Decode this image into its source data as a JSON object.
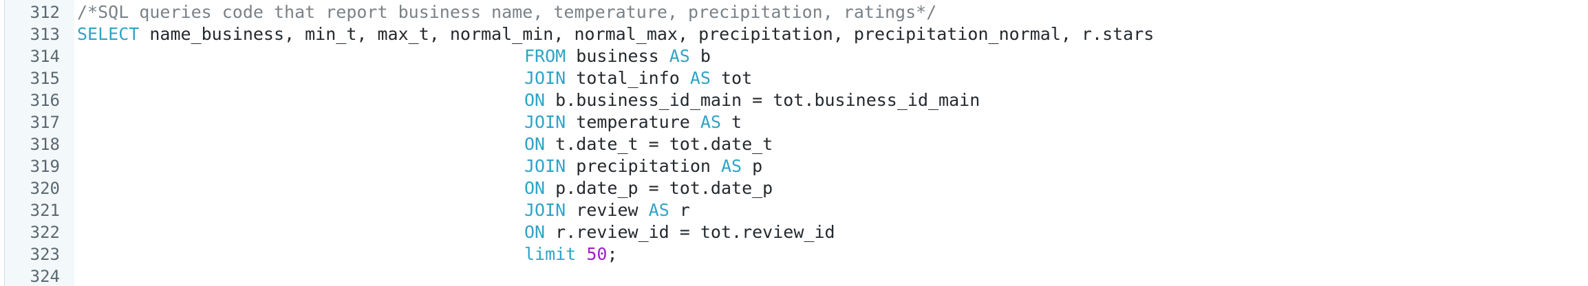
{
  "editor": {
    "lines": [
      {
        "num": "312",
        "indent": false,
        "tokens": [
          {
            "t": "comment",
            "v": "/*SQL queries code that report business name, temperature, precipitation, ratings*/"
          }
        ]
      },
      {
        "num": "313",
        "indent": false,
        "tokens": [
          {
            "t": "keyword",
            "v": "SELECT"
          },
          {
            "t": "plain",
            "v": " name_business, min_t, max_t, normal_min, normal_max, precipitation, precipitation_normal, r.stars"
          }
        ]
      },
      {
        "num": "314",
        "indent": true,
        "tokens": [
          {
            "t": "keyword",
            "v": "FROM"
          },
          {
            "t": "plain",
            "v": " business "
          },
          {
            "t": "keyword",
            "v": "AS"
          },
          {
            "t": "plain",
            "v": " b"
          }
        ]
      },
      {
        "num": "315",
        "indent": true,
        "tokens": [
          {
            "t": "keyword",
            "v": "JOIN"
          },
          {
            "t": "plain",
            "v": " total_info "
          },
          {
            "t": "keyword",
            "v": "AS"
          },
          {
            "t": "plain",
            "v": " tot"
          }
        ]
      },
      {
        "num": "316",
        "indent": true,
        "tokens": [
          {
            "t": "keyword",
            "v": "ON"
          },
          {
            "t": "plain",
            "v": " b.business_id_main = tot.business_id_main"
          }
        ]
      },
      {
        "num": "317",
        "indent": true,
        "tokens": [
          {
            "t": "keyword",
            "v": "JOIN"
          },
          {
            "t": "plain",
            "v": " temperature "
          },
          {
            "t": "keyword",
            "v": "AS"
          },
          {
            "t": "plain",
            "v": " t"
          }
        ]
      },
      {
        "num": "318",
        "indent": true,
        "tokens": [
          {
            "t": "keyword",
            "v": "ON"
          },
          {
            "t": "plain",
            "v": " t.date_t = tot.date_t"
          }
        ]
      },
      {
        "num": "319",
        "indent": true,
        "tokens": [
          {
            "t": "keyword",
            "v": "JOIN"
          },
          {
            "t": "plain",
            "v": " precipitation "
          },
          {
            "t": "keyword",
            "v": "AS"
          },
          {
            "t": "plain",
            "v": " p"
          }
        ]
      },
      {
        "num": "320",
        "indent": true,
        "tokens": [
          {
            "t": "keyword",
            "v": "ON"
          },
          {
            "t": "plain",
            "v": " p.date_p = tot.date_p"
          }
        ]
      },
      {
        "num": "321",
        "indent": true,
        "tokens": [
          {
            "t": "keyword",
            "v": "JOIN"
          },
          {
            "t": "plain",
            "v": " review "
          },
          {
            "t": "keyword",
            "v": "AS"
          },
          {
            "t": "plain",
            "v": " r"
          }
        ]
      },
      {
        "num": "322",
        "indent": true,
        "tokens": [
          {
            "t": "keyword",
            "v": "ON"
          },
          {
            "t": "plain",
            "v": " r.review_id = tot.review_id"
          }
        ]
      },
      {
        "num": "323",
        "indent": true,
        "tokens": [
          {
            "t": "keyword",
            "v": "limit"
          },
          {
            "t": "plain",
            "v": " "
          },
          {
            "t": "number",
            "v": "50"
          },
          {
            "t": "plain",
            "v": ";"
          }
        ]
      },
      {
        "num": "324",
        "indent": false,
        "tokens": []
      }
    ]
  },
  "colors": {
    "keyword": "#2fa3c7",
    "comment": "#7a8288",
    "number": "#a01ec8",
    "gutter_background": "#f3f9fb"
  }
}
